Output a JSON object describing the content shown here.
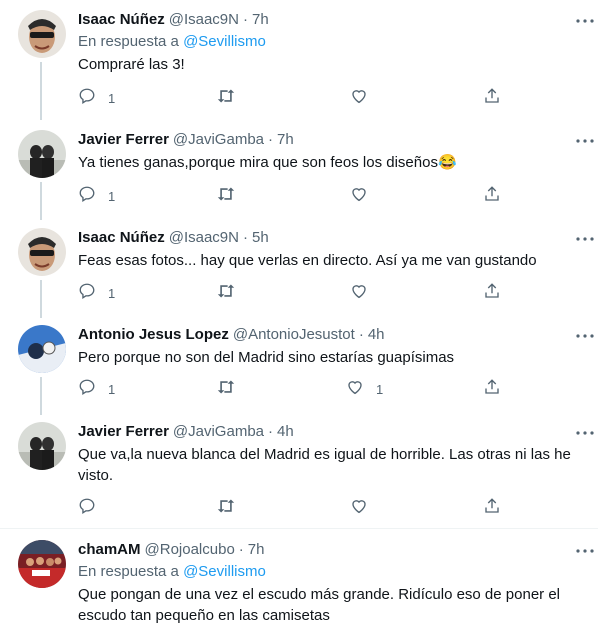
{
  "icons": {
    "reply": "reply-icon",
    "retweet": "retweet-icon",
    "like": "like-icon",
    "share": "share-icon",
    "more": "more-icon"
  },
  "colors": {
    "accent": "#1d9bf0",
    "muted": "#536471",
    "thread_line": "#cfd9de"
  },
  "tweets": [
    {
      "name": "Isaac Núñez",
      "handle": "@Isaac9N",
      "dot": "·",
      "time": "7h",
      "reply_prefix": "En respuesta a ",
      "reply_mention": "@Sevillismo",
      "text": "Compraré las 3!",
      "reply_count": "1",
      "like_count": ""
    },
    {
      "name": "Javier Ferrer",
      "handle": "@JaviGamba",
      "dot": "·",
      "time": "7h",
      "text": "Ya tienes ganas,porque mira que son feos los diseños😂",
      "reply_count": "1",
      "like_count": ""
    },
    {
      "name": "Isaac Núñez",
      "handle": "@Isaac9N",
      "dot": "·",
      "time": "5h",
      "text": "Feas esas fotos... hay que verlas en directo. Así ya me van gustando",
      "reply_count": "1",
      "like_count": ""
    },
    {
      "name": "Antonio Jesus Lopez",
      "handle": "@AntonioJesustot",
      "dot": "·",
      "time": "4h",
      "text": "Pero porque no son del Madrid sino estarías guapísimas",
      "reply_count": "1",
      "like_count": "1"
    },
    {
      "name": "Javier Ferrer",
      "handle": "@JaviGamba",
      "dot": "·",
      "time": "4h",
      "text": "Que va,la nueva blanca del Madrid es igual de horrible. Las otras ni las he visto.",
      "reply_count": "",
      "like_count": ""
    },
    {
      "name": "chamAM",
      "handle": "@Rojoalcubo",
      "dot": "·",
      "time": "7h",
      "reply_prefix": "En respuesta a ",
      "reply_mention": "@Sevillismo",
      "text": "Que pongan de una vez el escudo más grande. Ridículo eso de poner el escudo tan pequeño en las camisetas",
      "reply_count": "",
      "like_count": ""
    }
  ]
}
